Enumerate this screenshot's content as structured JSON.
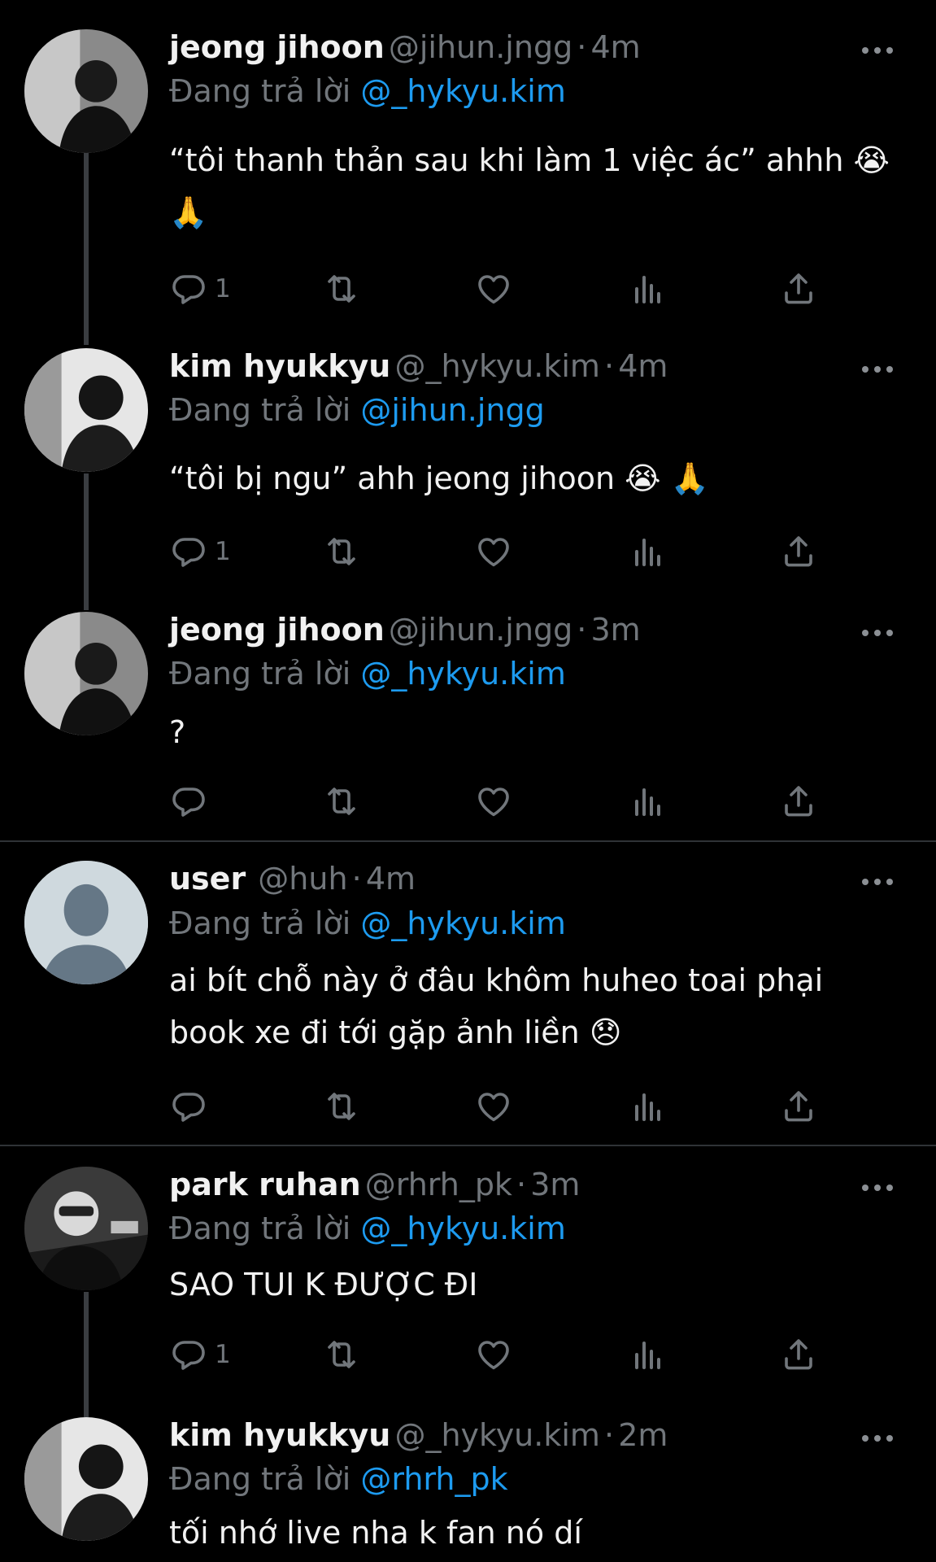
{
  "replying_prefix": "Đang trả lời",
  "tweets": [
    {
      "name": "jeong jihoon",
      "handle": "@jihun.jngg",
      "sep": "·",
      "time": "4m",
      "replying_to": "@_hykyu.kim",
      "text": "“tôi thanh thản sau khi làm 1 việc ác” ahhh 😭 🙏",
      "reply_count": "1"
    },
    {
      "name": "kim hyukkyu",
      "handle": "@_hykyu.kim",
      "sep": "·",
      "time": "4m",
      "replying_to": "@jihun.jngg",
      "text": "“tôi bị ngu” ahh jeong jihoon 😭 🙏",
      "reply_count": "1"
    },
    {
      "name": "jeong jihoon",
      "handle": "@jihun.jngg",
      "sep": "·",
      "time": "3m",
      "replying_to": "@_hykyu.kim",
      "text": "?",
      "reply_count": ""
    },
    {
      "name": "user",
      "handle": "@huh",
      "sep": "·",
      "time": "4m",
      "replying_to": "@_hykyu.kim",
      "text": "ai bít chỗ này ở đâu khôm huheo toai phại book xe đi tới gặp ảnh liền 😞",
      "reply_count": ""
    },
    {
      "name": "park ruhan",
      "handle": "@rhrh_pk",
      "sep": "·",
      "time": "3m",
      "replying_to": "@_hykyu.kim",
      "text": "SAO TUI K ĐƯỢC ĐI",
      "reply_count": "1"
    },
    {
      "name": "kim hyukkyu",
      "handle": "@_hykyu.kim",
      "sep": "·",
      "time": "2m",
      "replying_to": "@rhrh_pk",
      "text": "tối nhớ live nha k fan nó dí",
      "reply_count": ""
    }
  ],
  "colors": {
    "background": "#000000",
    "text": "#e7e9ea",
    "muted": "#71767b",
    "link": "#1d9bf0",
    "divider": "#2f3336"
  },
  "icons": [
    "more-icon",
    "reply-icon",
    "retweet-icon",
    "like-icon",
    "views-icon",
    "share-icon"
  ]
}
